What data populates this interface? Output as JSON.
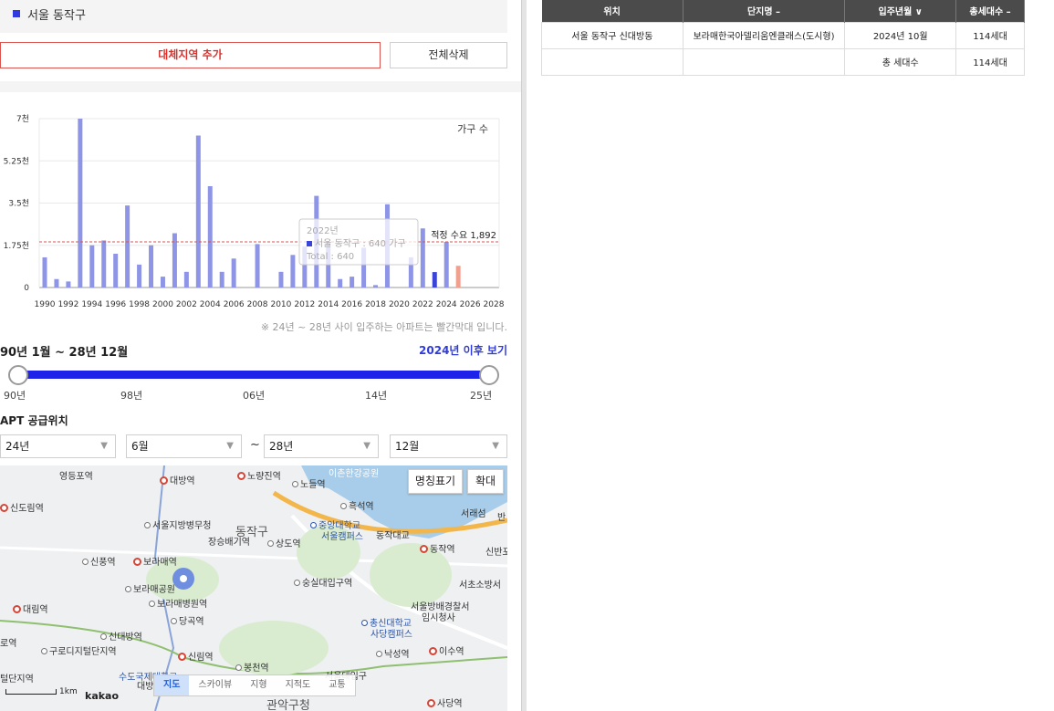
{
  "region": {
    "label": "서울 동작구",
    "color": "#2f3bde"
  },
  "buttons": {
    "add_region": "대체지역 추가",
    "delete_all": "전체삭제"
  },
  "chart_data": {
    "type": "bar",
    "legend_label": "가구 수",
    "y_ticks": [
      "0",
      "1.75천",
      "3.5천",
      "5.25천",
      "7천"
    ],
    "ylim": [
      0,
      7000
    ],
    "x_tick_labels": [
      "1990",
      "1992",
      "1994",
      "1996",
      "1998",
      "2000",
      "2002",
      "2004",
      "2006",
      "2008",
      "2010",
      "2012",
      "2014",
      "2016",
      "2018",
      "2020",
      "2022",
      "2024",
      "2026",
      "2028"
    ],
    "years": [
      1990,
      1991,
      1992,
      1993,
      1994,
      1995,
      1996,
      1997,
      1998,
      1999,
      2000,
      2001,
      2002,
      2003,
      2004,
      2005,
      2006,
      2007,
      2008,
      2009,
      2010,
      2011,
      2012,
      2013,
      2014,
      2015,
      2016,
      2017,
      2018,
      2019,
      2020,
      2021,
      2022,
      2023,
      2024,
      2025,
      2026,
      2027,
      2028
    ],
    "values": [
      1250,
      350,
      250,
      7000,
      1750,
      1950,
      1400,
      3400,
      950,
      1750,
      450,
      2250,
      650,
      6300,
      4200,
      650,
      1200,
      0,
      1800,
      0,
      650,
      1350,
      1700,
      3800,
      1850,
      350,
      450,
      1650,
      100,
      3450,
      0,
      1250,
      2450,
      640,
      1892,
      900,
      0,
      0,
      0
    ],
    "highlight_year": 2023,
    "future_years": [
      2025
    ],
    "reference_line": {
      "label": "적정 수요 1,892",
      "value": 1892
    },
    "tooltip": {
      "year": "2022년",
      "series": "서울 동작구 : 640 가구",
      "total": "Total : 640"
    },
    "colors": {
      "bar": "#8f95e6",
      "highlight": "#3b44d8",
      "future": "#f1a090",
      "reference": "#d9534f"
    },
    "note": "※ 24년 ~ 28년 사이 입주하는 아파트는 빨간막대 입니다."
  },
  "period": {
    "label": "90년 1월 ~ 28년 12월",
    "after_link": "2024년 이후 보기",
    "ticks": [
      "90년",
      "98년",
      "06년",
      "14년",
      "25년"
    ]
  },
  "supply": {
    "label": "APT 공급위치",
    "start_year": "24년",
    "start_month": "6월",
    "end_year": "28년",
    "end_month": "12월",
    "separator": "~"
  },
  "map": {
    "buttons": {
      "names": "명칭표기",
      "zoom": "확대"
    },
    "tabs": [
      "지도",
      "스카이뷰",
      "지형",
      "지적도",
      "교통"
    ],
    "active_tab": "지도",
    "scale": "1km",
    "logo": "kakao",
    "labels": [
      "영등포역",
      "대방역",
      "노량진역",
      "노들역",
      "이촌한강공원",
      "흑석역",
      "서래섬",
      "신도림역",
      "서울지방병무청",
      "동작구",
      "장승배기역",
      "상도역",
      "중앙대학교",
      "서울캠퍼스",
      "동작대교",
      "동작역",
      "신반포",
      "신풍역",
      "보라매역",
      "숭실대입구역",
      "서초소방서",
      "보라매공원",
      "보라매병원역",
      "서울방배경찰서",
      "임시청사",
      "당곡역",
      "대림역",
      "총신대학교",
      "사당캠퍼스",
      "신대방역",
      "구로디지털단지역",
      "신림역",
      "봉천역",
      "낙성역",
      "이수역",
      "수도국제대학교",
      "관악구청",
      "서울대입구",
      "사당역",
      "반",
      "대방",
      "털단지역",
      "로역"
    ]
  },
  "table": {
    "headers": [
      "위치",
      "단지명 –",
      "입주년월 ∨",
      "총세대수 –"
    ],
    "rows": [
      [
        "서울 동작구 신대방동",
        "보라매한국아델리움엔클래스(도시형)",
        "2024년 10월",
        "114세대"
      ],
      [
        "",
        "",
        "총 세대수",
        "114세대"
      ]
    ]
  }
}
